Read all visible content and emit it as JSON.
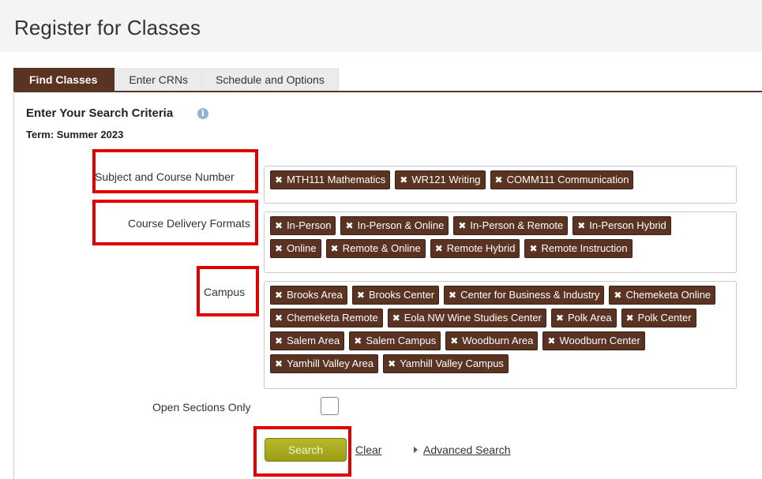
{
  "page": {
    "title": "Register for Classes"
  },
  "tabs": [
    {
      "label": "Find Classes",
      "active": true
    },
    {
      "label": "Enter CRNs",
      "active": false
    },
    {
      "label": "Schedule and Options",
      "active": false
    }
  ],
  "search": {
    "heading": "Enter Your Search Criteria",
    "info_icon": "i",
    "term": "Term: Summer 2023",
    "subject": {
      "label": "Subject and Course Number",
      "tags": [
        "MTH111 Mathematics",
        "WR121 Writing",
        "COMM111 Communication"
      ]
    },
    "delivery": {
      "label": "Course Delivery Formats",
      "tags": [
        "In-Person",
        "In-Person & Online",
        "In-Person & Remote",
        "In-Person Hybrid",
        "Online",
        "Remote & Online",
        "Remote Hybrid",
        "Remote Instruction"
      ]
    },
    "campus": {
      "label": "Campus",
      "tags": [
        "Brooks Area",
        "Brooks Center",
        "Center for Business & Industry",
        "Chemeketa Online",
        "Chemeketa Remote",
        "Eola NW Wine Studies Center",
        "Polk Area",
        "Polk Center",
        "Salem Area",
        "Salem Campus",
        "Woodburn Area",
        "Woodburn Center",
        "Yamhill Valley Area",
        "Yamhill Valley Campus"
      ]
    },
    "open_sections": {
      "label": "Open Sections Only",
      "checked": false
    },
    "search_button": "Search",
    "clear_link": "Clear",
    "advanced_link": "Advanced Search"
  },
  "tag_remove_glyph": "✖",
  "colors": {
    "brand_brown": "#5a3322",
    "search_button": "#a9ac1f",
    "highlight_red": "#e00000",
    "info_icon": "#8db3d6"
  }
}
